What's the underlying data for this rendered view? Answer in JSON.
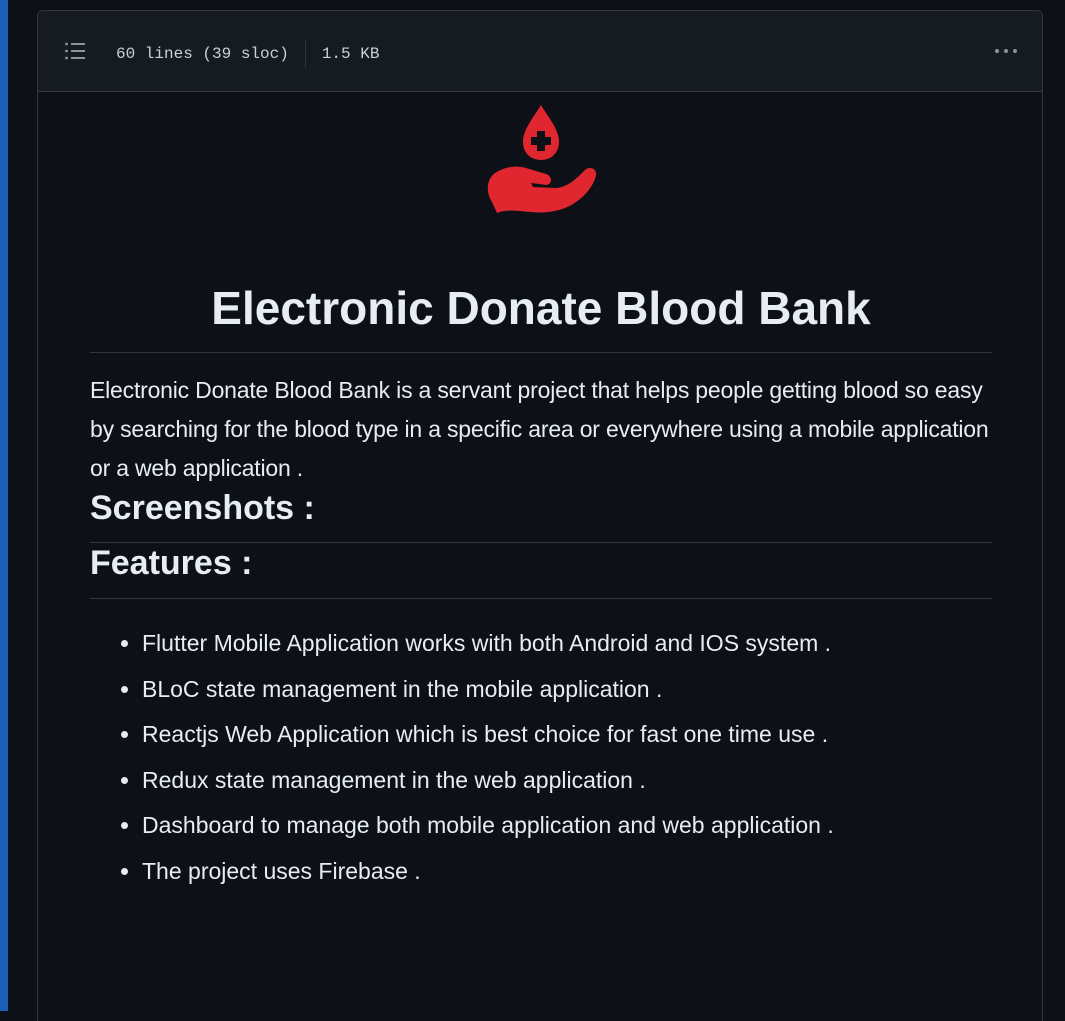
{
  "file_header": {
    "lines": "60 lines (39 sloc)",
    "size": "1.5 KB"
  },
  "icons": {
    "toc": "list-unordered-icon",
    "more": "kebab-horizontal-icon",
    "logo": "blood-donation-hand-icon"
  },
  "colors": {
    "accent_red": "#e0262f",
    "background": "#0d1117",
    "header_bg": "#161b22",
    "border": "#30363d"
  },
  "readme": {
    "title": "Electronic Donate Blood Bank",
    "description": "Electronic Donate Blood Bank is a servant project that helps people getting blood so easy by searching for the blood type in a specific area or everywhere using a mobile application or a web application .",
    "screenshots_heading": "Screenshots :",
    "features_heading": "Features :",
    "features": [
      "Flutter Mobile Application works with both Android and IOS system .",
      "BLoC state management in the mobile application .",
      "Reactjs Web Application which is best choice for fast one time use .",
      "Redux state management in the web application .",
      "Dashboard to manage both mobile application and web application .",
      "The project uses Firebase ."
    ]
  }
}
